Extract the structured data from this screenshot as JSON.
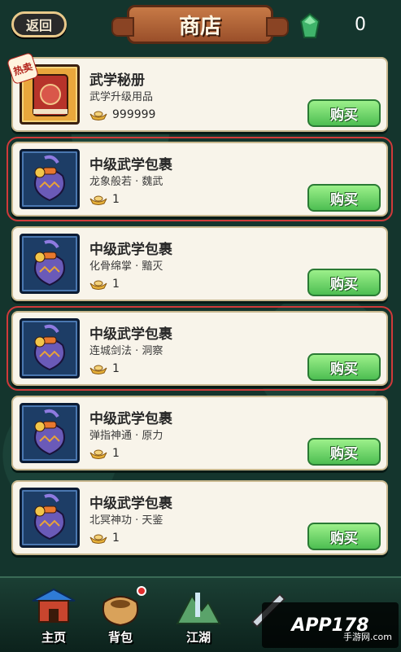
{
  "header": {
    "back_label": "返回",
    "title": "商店",
    "gem_count": "0"
  },
  "items": [
    {
      "name": "武学秘册",
      "desc": "武学升级用品",
      "price": "999999",
      "buy_label": "购买",
      "hot": "热卖"
    },
    {
      "name": "中级武学包裹",
      "desc": "龙象般若 · 魏武",
      "price": "1",
      "buy_label": "购买"
    },
    {
      "name": "中级武学包裹",
      "desc": "化骨绵掌 · 黯灭",
      "price": "1",
      "buy_label": "购买"
    },
    {
      "name": "中级武学包裹",
      "desc": "连城剑法 · 洞察",
      "price": "1",
      "buy_label": "购买"
    },
    {
      "name": "中级武学包裹",
      "desc": "弹指神通 · 原力",
      "price": "1",
      "buy_label": "购买"
    },
    {
      "name": "中级武学包裹",
      "desc": "北冥神功 · 天鉴",
      "price": "1",
      "buy_label": "购买"
    }
  ],
  "nav": {
    "home": "主页",
    "bag": "背包",
    "jianghu": "江湖"
  },
  "watermark": {
    "text": "APP178",
    "sub": "手游网.com"
  },
  "colors": {
    "buy_button": "#4dbe52",
    "card_bg": "#f8f4ea",
    "highlight": "#d03a3a"
  }
}
